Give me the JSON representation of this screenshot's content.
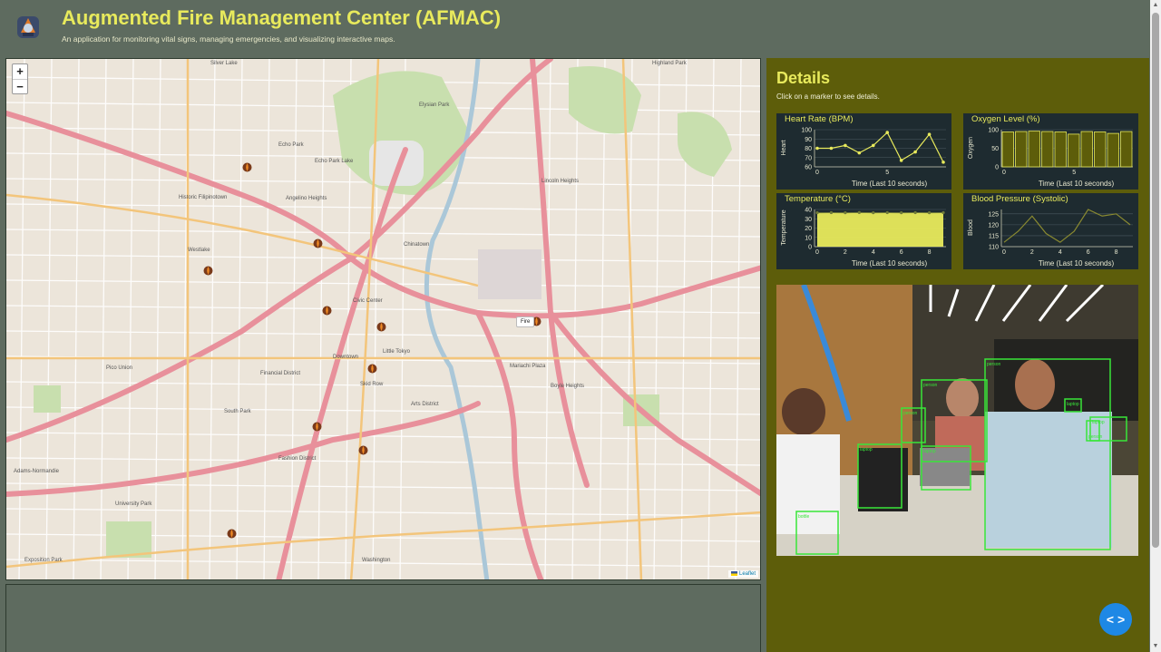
{
  "header": {
    "title": "Augmented Fire Management Center (AFMAC)",
    "subtitle": "An application for monitoring vital signs, managing emergencies, and visualizing interactive maps.",
    "logo_icon": "firefighter-logo-icon"
  },
  "map": {
    "zoom_in": "+",
    "zoom_out": "−",
    "attribution": "Leaflet",
    "tooltip": "Fire",
    "labels": [
      "Silver Lake",
      "Echo Park",
      "Elysian Park",
      "Historic Filipinotown",
      "Angelino Heights",
      "Westlake",
      "Chinatown",
      "Lincoln Heights",
      "Civic Center",
      "Little Tokyo",
      "Financial District",
      "Downtown",
      "Skid Row",
      "Arts District",
      "Boyle Heights",
      "Pico Union",
      "South Park",
      "Fashion District",
      "Adams-Normandie",
      "University Park",
      "Exposition Park",
      "Mariachi Plaza",
      "Washington",
      "Highland Park",
      "Echo Park Lake"
    ],
    "marker_icon": "fire-marker-icon"
  },
  "details": {
    "title": "Details",
    "subtitle": "Click on a marker to see details.",
    "charts": [
      {
        "title": "Heart Rate (BPM)",
        "xlabel": "Time (Last 10 seconds)",
        "ylabel": "Heart",
        "color": "#e8ea5c"
      },
      {
        "title": "Oxygen Level (%)",
        "xlabel": "Time (Last 10 seconds)",
        "ylabel": "Oxygen",
        "color": "#5d5d0a"
      },
      {
        "title": "Temperature (°C)",
        "xlabel": "Time (Last 10 seconds)",
        "ylabel": "Temperature",
        "color": "#e8ea5c"
      },
      {
        "title": "Blood Pressure (Systolic)",
        "xlabel": "Time (Last 10 seconds)",
        "ylabel": "Blood",
        "color": "#5d5d0a"
      }
    ],
    "video_icon": "live-camera-feed",
    "detections": [
      "laptop",
      "laptop",
      "person",
      "person",
      "person",
      "bottle",
      "laptop",
      "laptop",
      "person"
    ]
  },
  "fab": {
    "label": "< >",
    "icon": "code-icon"
  },
  "chart_data": [
    {
      "type": "line",
      "title": "Heart Rate (BPM)",
      "xlabel": "Time (Last 10 seconds)",
      "ylabel": "Heart",
      "x": [
        0,
        1,
        2,
        3,
        4,
        5,
        6,
        7,
        8,
        9
      ],
      "series": [
        {
          "values": [
            80,
            80,
            83,
            75,
            83,
            97,
            67,
            76,
            95,
            65
          ]
        }
      ],
      "ylim": [
        60,
        100
      ],
      "yticks": [
        60,
        70,
        80,
        90,
        100
      ],
      "xticks": [
        0,
        5
      ],
      "grid": true
    },
    {
      "type": "bar",
      "title": "Oxygen Level (%)",
      "xlabel": "Time (Last 10 seconds)",
      "ylabel": "Oxygen",
      "x": [
        0,
        1,
        2,
        3,
        4,
        5,
        6,
        7,
        8,
        9
      ],
      "values": [
        94,
        95,
        96,
        95,
        94,
        88,
        95,
        94,
        90,
        95
      ],
      "ylim": [
        0,
        100
      ],
      "yticks": [
        0,
        50,
        100
      ],
      "xticks": [
        0,
        5
      ],
      "grid": true
    },
    {
      "type": "area",
      "title": "Temperature (°C)",
      "xlabel": "Time (Last 10 seconds)",
      "ylabel": "Temperature",
      "x": [
        0,
        1,
        2,
        3,
        4,
        5,
        6,
        7,
        8,
        9
      ],
      "series": [
        {
          "values": [
            36.5,
            36.6,
            36.5,
            36.7,
            36.5,
            36.6,
            36.5,
            36.6,
            36.5,
            36.6
          ]
        }
      ],
      "ylim": [
        0,
        40
      ],
      "yticks": [
        0,
        10,
        20,
        30,
        40
      ],
      "xticks": [
        0,
        2,
        4,
        6,
        8
      ],
      "grid": true
    },
    {
      "type": "line",
      "title": "Blood Pressure (Systolic)",
      "xlabel": "Time (Last 10 seconds)",
      "ylabel": "Blood",
      "x": [
        0,
        1,
        2,
        3,
        4,
        5,
        6,
        7,
        8,
        9
      ],
      "series": [
        {
          "values": [
            112,
            117,
            124,
            116,
            112,
            117,
            127,
            124,
            125,
            120
          ]
        }
      ],
      "ylim": [
        110,
        127
      ],
      "yticks": [
        110,
        115,
        120,
        125
      ],
      "xticks": [
        0,
        2,
        4,
        6,
        8
      ],
      "grid": true
    }
  ]
}
